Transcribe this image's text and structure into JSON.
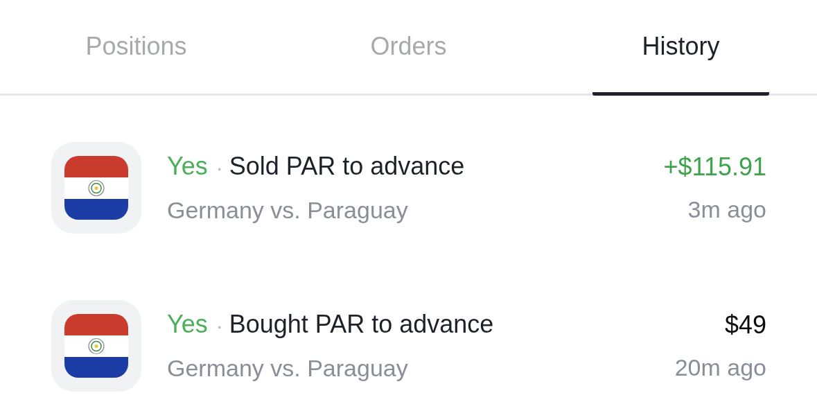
{
  "tabs": [
    {
      "label": "Positions",
      "selected": false
    },
    {
      "label": "Orders",
      "selected": false
    },
    {
      "label": "History",
      "selected": true
    }
  ],
  "history": [
    {
      "kind": "sell",
      "outcome": "Yes",
      "separator": "·",
      "action": "Sold PAR to advance",
      "market": "Germany vs. Paraguay",
      "amount": "+$115.91",
      "time": "3m ago"
    },
    {
      "kind": "buy",
      "outcome": "Yes",
      "separator": "·",
      "action": "Bought PAR to advance",
      "market": "Germany vs. Paraguay",
      "amount": "$49",
      "time": "20m ago"
    }
  ]
}
